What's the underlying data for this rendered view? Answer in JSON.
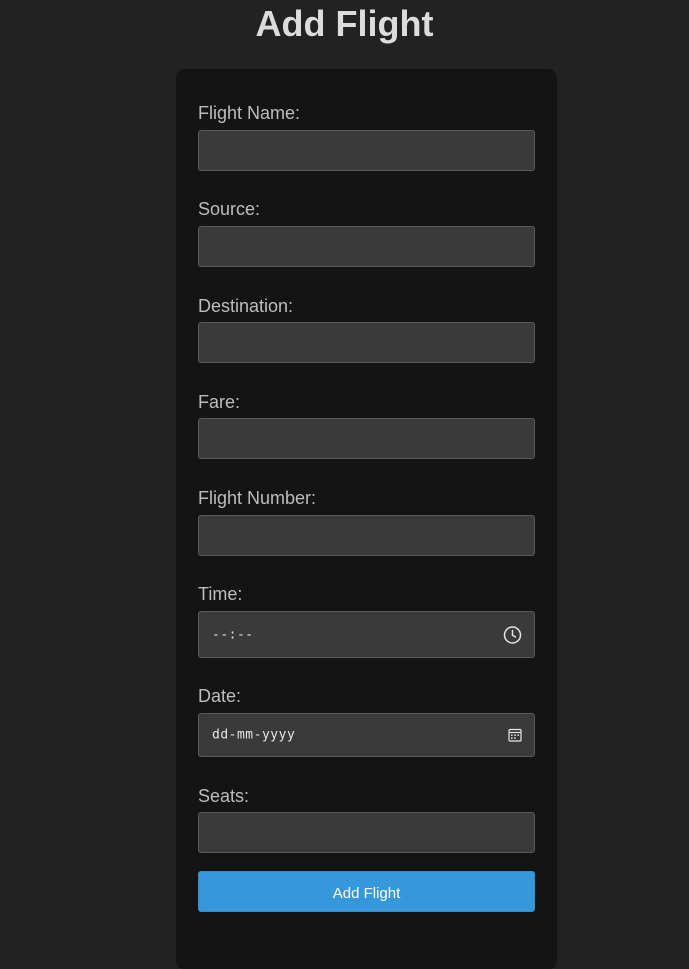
{
  "page": {
    "title": "Add Flight"
  },
  "form": {
    "fields": [
      {
        "label": "Flight Name:",
        "value": ""
      },
      {
        "label": "Source:",
        "value": ""
      },
      {
        "label": "Destination:",
        "value": ""
      },
      {
        "label": "Fare:",
        "value": ""
      },
      {
        "label": "Flight Number:",
        "value": ""
      },
      {
        "label": "Time:",
        "placeholder": "--:--",
        "icon": "clock-icon"
      },
      {
        "label": "Date:",
        "placeholder": "dd-mm-yyyy",
        "icon": "calendar-icon"
      },
      {
        "label": "Seats:",
        "value": ""
      }
    ],
    "submit_label": "Add Flight"
  },
  "colors": {
    "page_background": "#222222",
    "card_background": "#141414",
    "input_background": "#3a3a3a",
    "accent": "#3498db"
  }
}
